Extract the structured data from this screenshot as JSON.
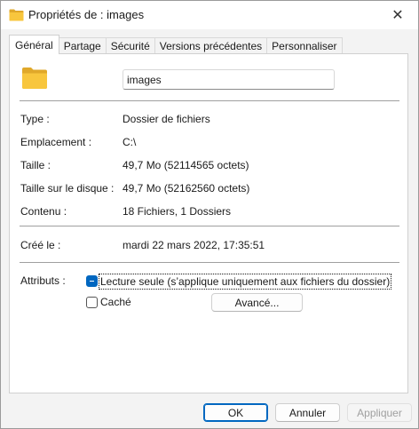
{
  "window": {
    "title": "Propriétés de : images",
    "close_glyph": "✕"
  },
  "tabs": [
    {
      "label": "Général",
      "active": true
    },
    {
      "label": "Partage",
      "active": false
    },
    {
      "label": "Sécurité",
      "active": false
    },
    {
      "label": "Versions précédentes",
      "active": false
    },
    {
      "label": "Personnaliser",
      "active": false
    }
  ],
  "general": {
    "name_value": "images",
    "type_label": "Type :",
    "type_value": "Dossier de fichiers",
    "location_label": "Emplacement :",
    "location_value": "C:\\",
    "size_label": "Taille :",
    "size_value": "49,7 Mo (52114565 octets)",
    "disk_size_label": "Taille sur le disque :",
    "disk_size_value": "49,7 Mo (52162560 octets)",
    "contents_label": "Contenu :",
    "contents_value": "18 Fichiers, 1 Dossiers",
    "created_label": "Créé le :",
    "created_value": "mardi 22 mars 2022, 17:35:51",
    "attributes_label": "Attributs :",
    "readonly_label": "Lecture seule (s’applique uniquement aux fichiers du dossier)",
    "readonly_state": "indeterminate",
    "hidden_label": "Caché",
    "hidden_state": "unchecked",
    "advanced_button": "Avancé..."
  },
  "footer": {
    "ok_label": "OK",
    "cancel_label": "Annuler",
    "apply_label": "Appliquer"
  },
  "colors": {
    "accent": "#0067c0",
    "folder_yellow": "#f8c63d",
    "folder_dark": "#e0a82a"
  },
  "icons": {
    "title_icon": "folder-icon",
    "big_icon": "folder-icon"
  }
}
